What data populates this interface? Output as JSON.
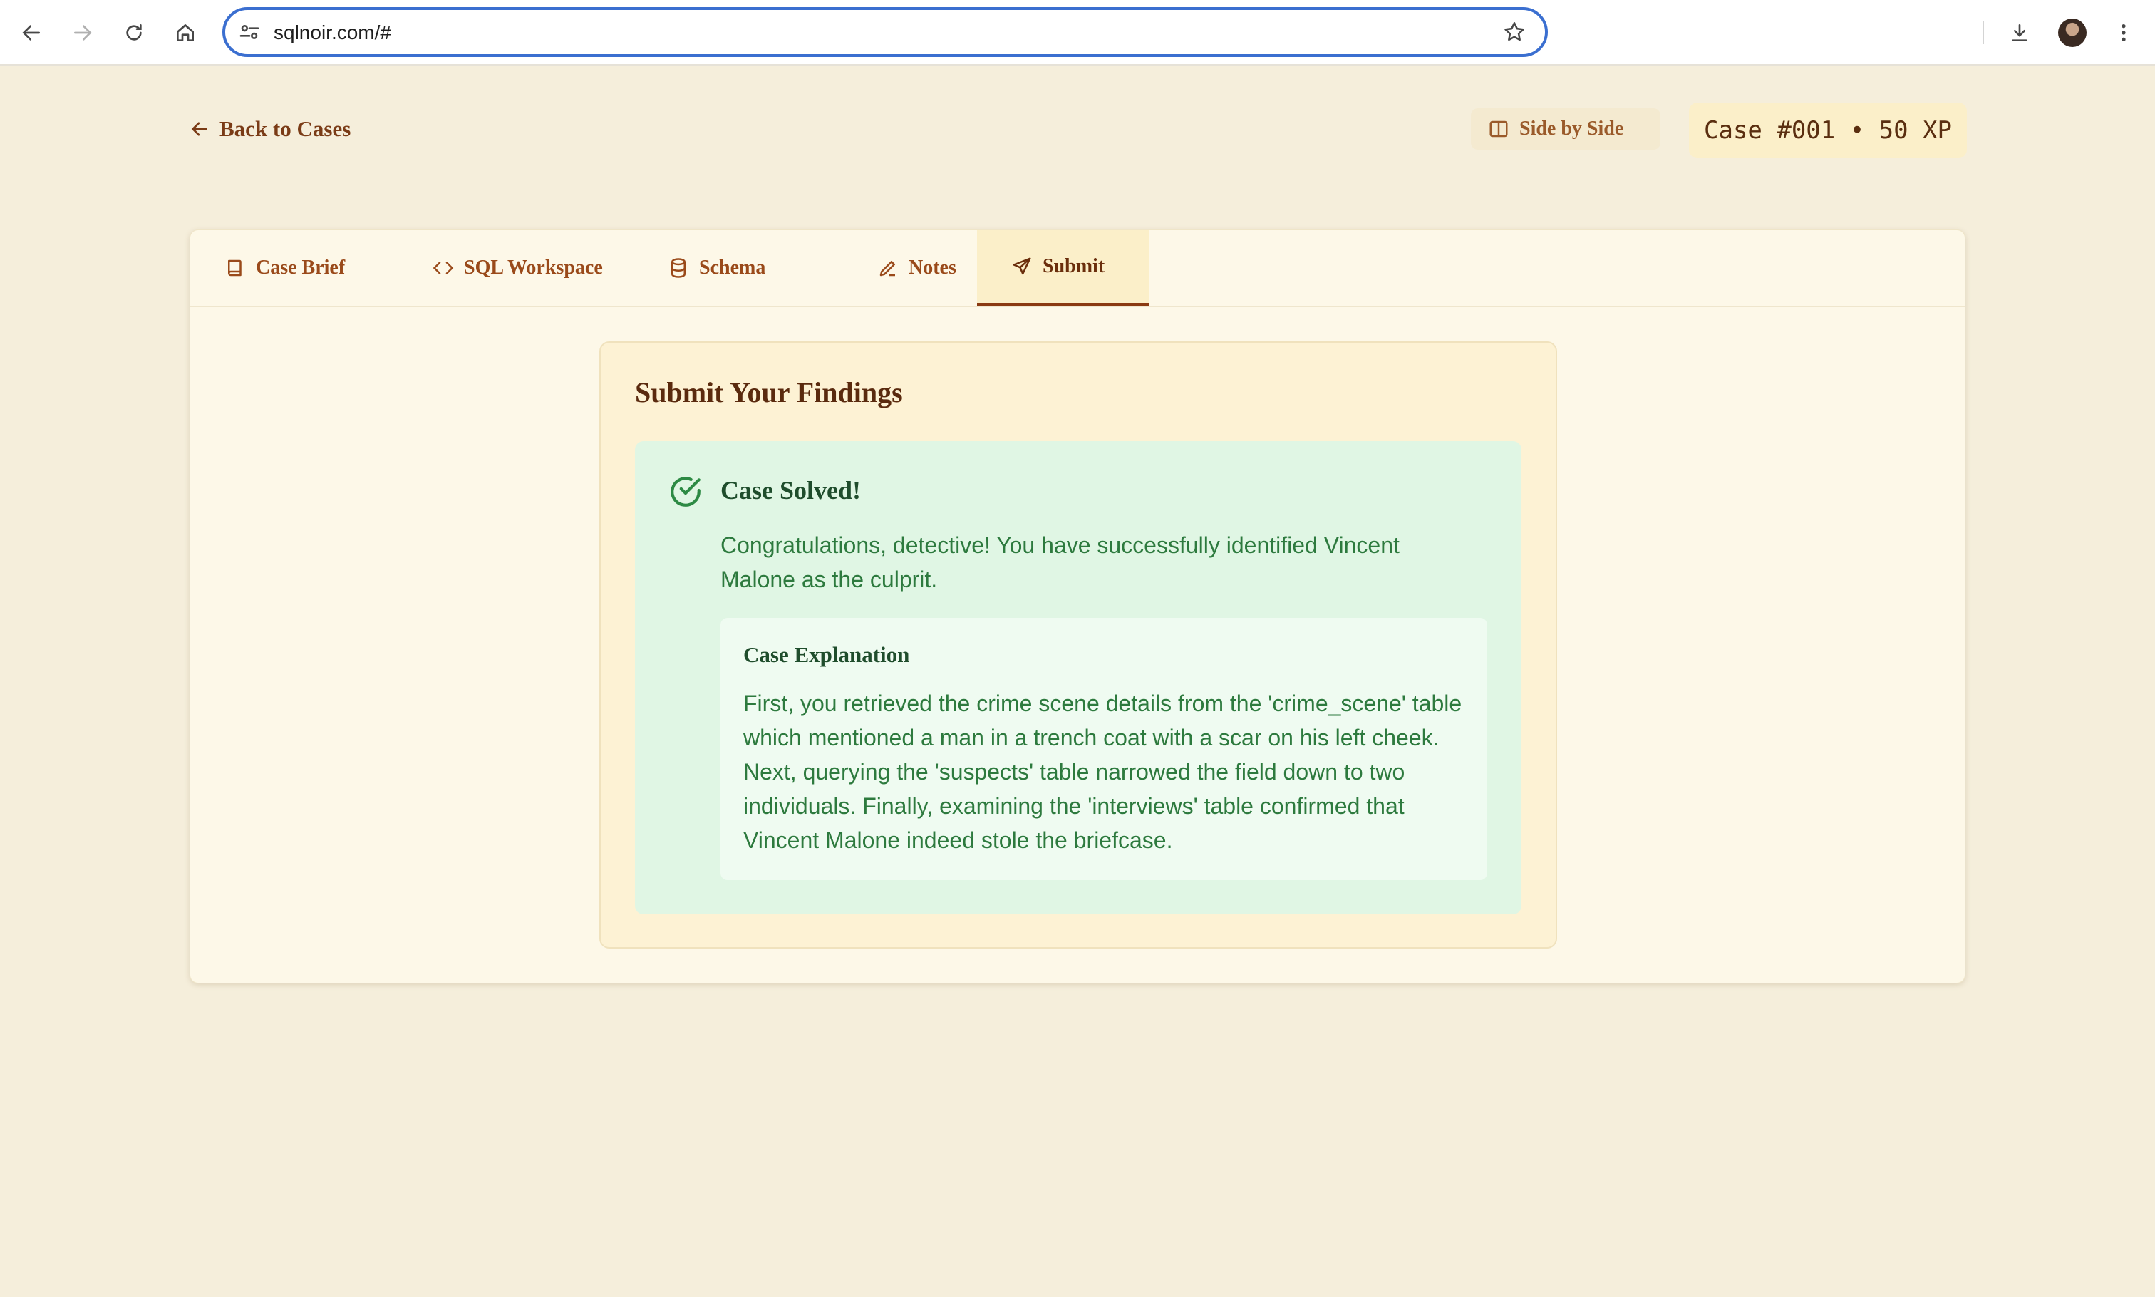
{
  "browser": {
    "url": "sqlnoir.com/#",
    "icons": {
      "back": "arrow-left-icon",
      "forward": "arrow-right-icon",
      "reload": "reload-icon",
      "home": "home-icon",
      "site_info": "tune-icon",
      "bookmark": "star-icon",
      "downloads": "download-icon",
      "menu": "more-vert-icon"
    }
  },
  "header": {
    "back_label": "Back to Cases",
    "side_by_side_label": "Side by Side",
    "case_badge": "Case #001 • 50 XP"
  },
  "tabs": [
    {
      "label": "Case Brief",
      "icon": "book-icon",
      "active": false
    },
    {
      "label": "SQL Workspace",
      "icon": "code-icon",
      "active": false
    },
    {
      "label": "Schema",
      "icon": "database-icon",
      "active": false
    },
    {
      "label": "Notes",
      "icon": "pencil-icon",
      "active": false
    },
    {
      "label": "Submit",
      "icon": "send-icon",
      "active": true
    }
  ],
  "submit": {
    "title": "Submit Your Findings",
    "solved_title": "Case Solved!",
    "solved_message": "Congratulations, detective! You have successfully identified Vincent Malone as the culprit.",
    "explanation_title": "Case Explanation",
    "explanation_text": "First, you retrieved the crime scene details from the 'crime_scene' table which mentioned a man in a trench coat with a scar on his left cheek. Next, querying the 'suspects' table narrowed the field down to two individuals. Finally, examining the 'interviews' table confirmed that Vincent Malone indeed stole the briefcase."
  },
  "colors": {
    "page_bg": "#f5eedb",
    "accent_brown": "#7a3b16",
    "success_bg": "#e0f6e4",
    "success_text": "#2d7a3e"
  }
}
